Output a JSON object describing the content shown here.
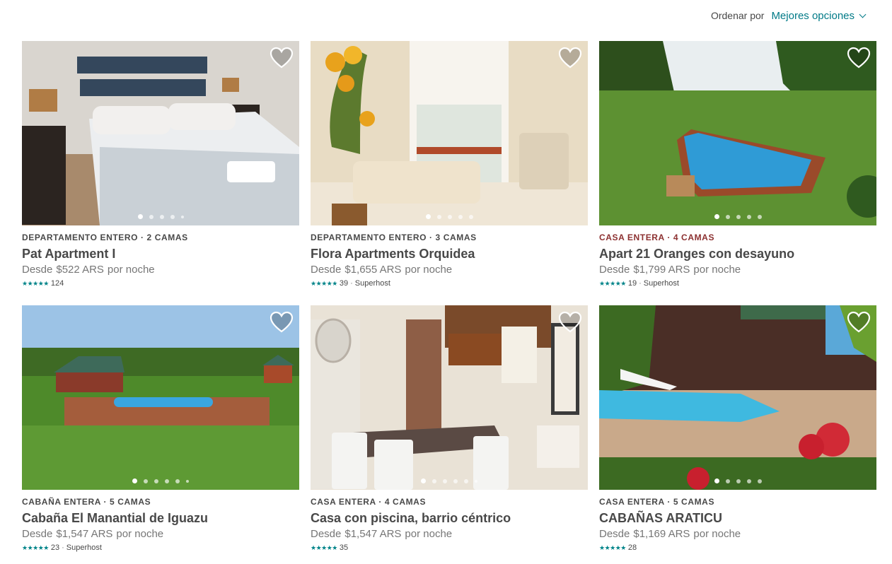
{
  "sort": {
    "label": "Ordenar por",
    "value": "Mejores opciones"
  },
  "listings": [
    {
      "kicker": "DEPARTAMENTO ENTERO · 2 CAMAS",
      "title": "Pat Apartment I",
      "price_prefix": "Desde",
      "price": "$522 ARS",
      "price_suffix": "por noche",
      "stars": "★★★★★",
      "reviews": "124",
      "badge": "",
      "rating": 4.5
    },
    {
      "kicker": "DEPARTAMENTO ENTERO · 3 CAMAS",
      "title": "Flora Apartments Orquidea",
      "price_prefix": "Desde",
      "price": "$1,655 ARS",
      "price_suffix": "por noche",
      "stars": "★★★★★",
      "reviews": "39",
      "badge": "Superhost",
      "rating": 5
    },
    {
      "kicker": "CASA ENTERA · 4 CAMAS",
      "title": "Apart 21 Oranges con desayuno",
      "price_prefix": "Desde",
      "price": "$1,799 ARS",
      "price_suffix": "por noche",
      "stars": "★★★★★",
      "reviews": "19",
      "badge": "Superhost",
      "rating": 5
    },
    {
      "kicker": "CABAÑA ENTERA · 5 CAMAS",
      "title": "Cabaña El Manantial de Iguazu",
      "price_prefix": "Desde",
      "price": "$1,547 ARS",
      "price_suffix": "por noche",
      "stars": "★★★★★",
      "reviews": "23",
      "badge": "Superhost",
      "rating": 5
    },
    {
      "kicker": "CASA ENTERA · 4 CAMAS",
      "title": "Casa con piscina, barrio céntrico",
      "price_prefix": "Desde",
      "price": "$1,547 ARS",
      "price_suffix": "por noche",
      "stars": "★★★★★",
      "reviews": "35",
      "badge": "",
      "rating": 4.5
    },
    {
      "kicker": "CASA ENTERA · 5 CAMAS",
      "title": "CABAÑAS ARATICU",
      "price_prefix": "Desde",
      "price": "$1,169 ARS",
      "price_suffix": "por noche",
      "stars": "★★★★★",
      "reviews": "28",
      "badge": "",
      "rating": 4.5
    }
  ],
  "colors": {
    "accent": "#007a87",
    "stars": "#008489",
    "kicker_highlight": "#8c3030",
    "text": "#484848",
    "muted": "#767676"
  },
  "icons": {
    "heart": "heart-outline-icon",
    "sort": "chevron-down-icon",
    "star": "star-icon"
  }
}
